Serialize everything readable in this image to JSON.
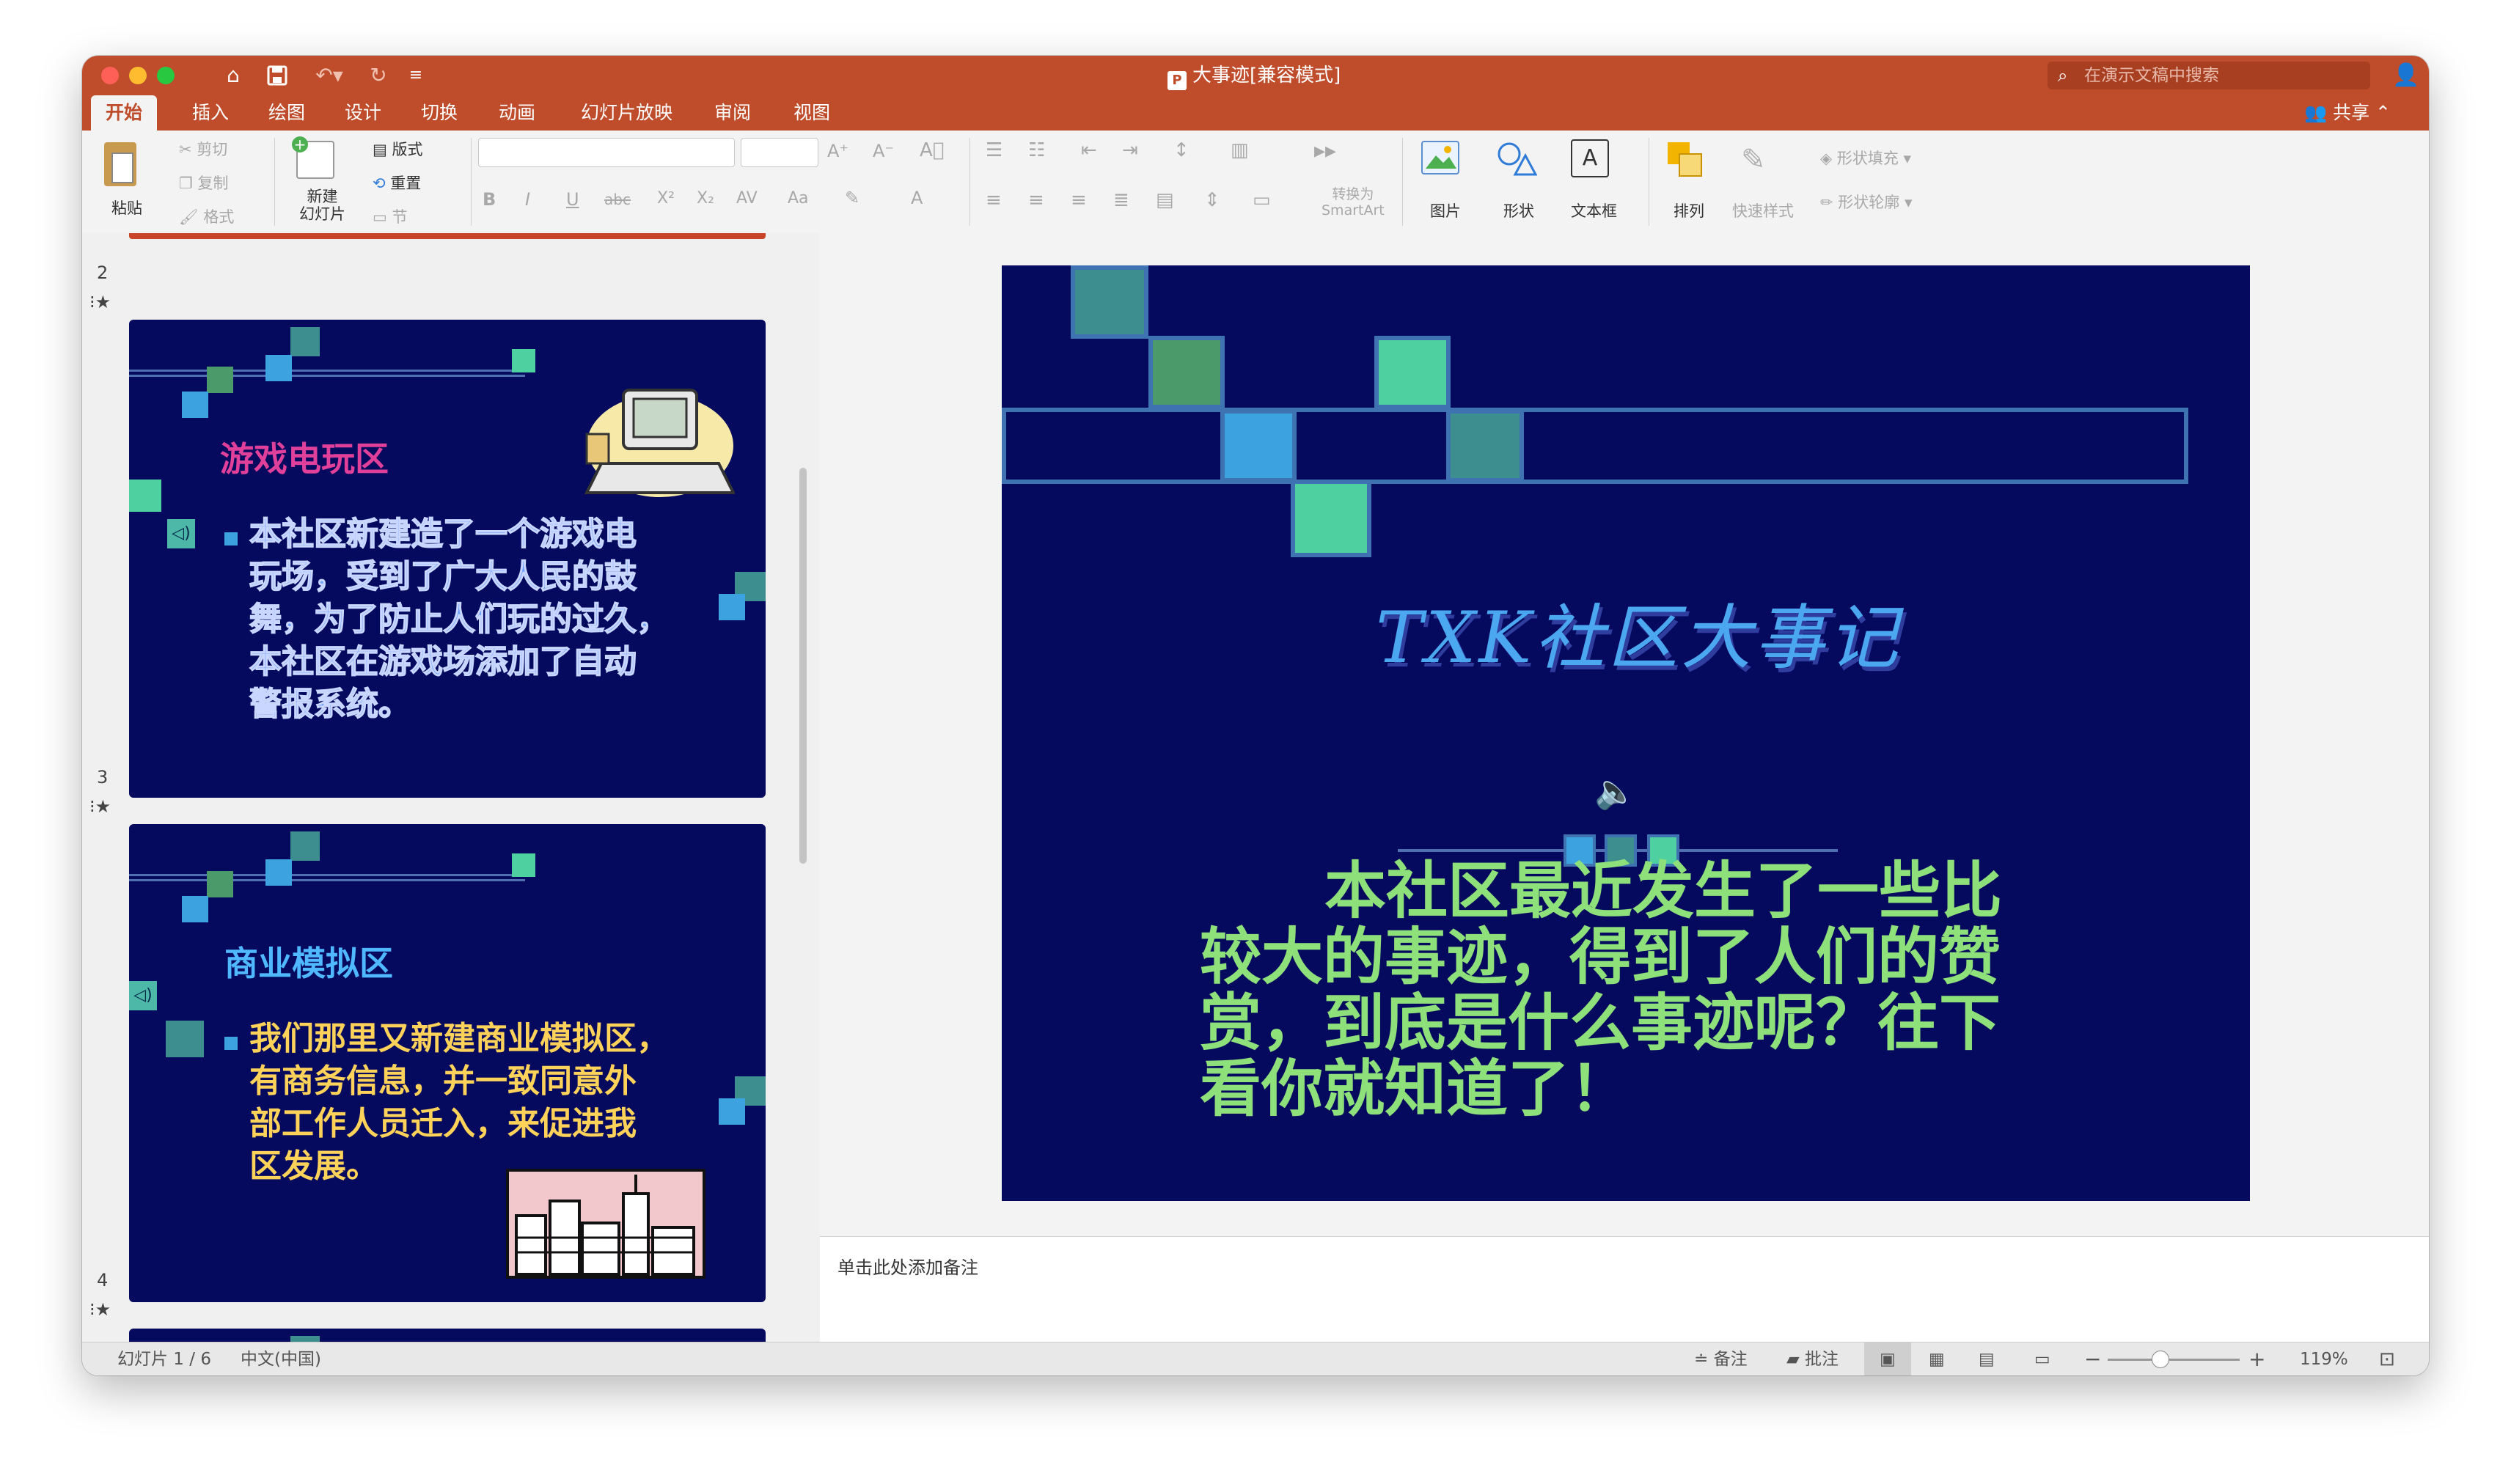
{
  "window": {
    "title": "大事迹[兼容模式]",
    "file_badge": "P",
    "search_placeholder": "在演示文稿中搜索",
    "toolbar_icons": [
      "home-icon",
      "save-icon",
      "undo-icon",
      "redo-icon",
      "customize-icon"
    ]
  },
  "tabs": [
    "开始",
    "插入",
    "绘图",
    "设计",
    "切换",
    "动画",
    "幻灯片放映",
    "审阅",
    "视图"
  ],
  "active_tab": "开始",
  "share_label": "共享",
  "ribbon": {
    "paste": "粘贴",
    "cut": "剪切",
    "copy": "复制",
    "format_painter": "格式",
    "new_slide": "新建\n幻灯片",
    "layout": "版式",
    "reset": "重置",
    "section": "节",
    "convert_smartart": "转换为\nSmartArt",
    "picture": "图片",
    "shape": "形状",
    "textbox": "文本框",
    "arrange": "排列",
    "quick_styles": "快速样式",
    "shape_fill": "形状填充",
    "shape_outline": "形状轮廓",
    "font_buttons": [
      "B",
      "I",
      "U",
      "abc",
      "X²",
      "X₂",
      "AV",
      "Aa",
      "A"
    ]
  },
  "thumbnails": [
    {
      "number": "2",
      "title": "游戏电玩区",
      "title_color": "#e0409a",
      "body": "本社区新建造了一个游戏电\n玩场，受到了广大人民的鼓\n舞，为了防止人们玩的过久，\n本社区在游戏场添加了自动\n警报系统。",
      "body_color": "#6ea0ff"
    },
    {
      "number": "3",
      "title": "商业模拟区",
      "title_color": "#4fb8ff",
      "body": "我们那里又新建商业模拟区，\n有商务信息，并一致同意外\n部工作人员迁入，来促进我\n区发展。",
      "body_color": "#ffd25a"
    },
    {
      "number": "4"
    }
  ],
  "slide": {
    "title": "TXK社区大事记",
    "body": "本社区最近发生了一些比较大的事迹，得到了人们的赞赏，到底是什么事迹呢？往下看你就知道了！",
    "colors": {
      "background": "#060a5f",
      "title": "#4aa7f0",
      "body": "#8ee07b"
    }
  },
  "notes_placeholder": "单击此处添加备注",
  "status": {
    "slide_counter": "幻灯片 1 / 6",
    "language": "中文(中国)",
    "notes": "备注",
    "comments": "批注",
    "zoom": "119%",
    "zoom_level": 0.4
  }
}
